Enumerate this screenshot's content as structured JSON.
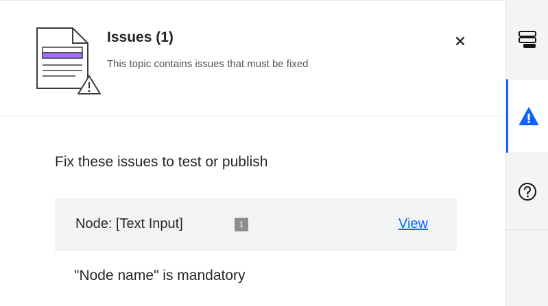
{
  "issues_panel": {
    "title": "Issues (1)",
    "subtitle": "This topic contains issues that must be fixed",
    "instruction": "Fix these issues to test or publish",
    "close_icon": "close-icon",
    "header_icon": "document-warning-icon"
  },
  "issue_item": {
    "node_label": "Node: [Text Input]",
    "count": "1",
    "view_label": "View",
    "message": "\"Node name\" is mandatory"
  },
  "side_rail": {
    "items": [
      {
        "icon": "layers-icon",
        "active": false
      },
      {
        "icon": "warning-icon",
        "active": true
      },
      {
        "icon": "help-icon",
        "active": false
      }
    ]
  },
  "colors": {
    "accent": "#0f62fe",
    "doc_highlight": "#a56eff",
    "badge": "#8d8d8d"
  }
}
